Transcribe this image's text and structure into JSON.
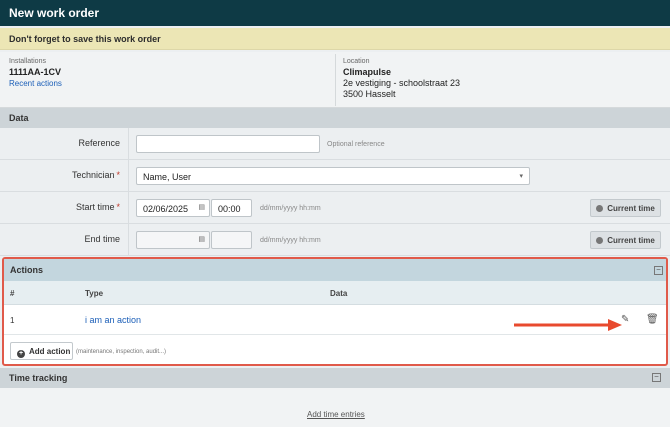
{
  "header": {
    "title": "New work order"
  },
  "banner": {
    "text": "Don't forget to save this work order"
  },
  "info": {
    "installations_label": "Installations",
    "installation_code": "1111AA-1CV",
    "recent_actions": "Recent actions",
    "location_label": "Location",
    "location_name": "Climapulse",
    "location_line1": "2e vestiging - schoolstraat 23",
    "location_line2": "3500 Hasselt"
  },
  "data_section": {
    "title": "Data",
    "reference": {
      "label": "Reference",
      "value": "",
      "hint": "Optional reference"
    },
    "technician": {
      "label": "Technician",
      "required": "*",
      "value": "Name, User"
    },
    "start_time": {
      "label": "Start time",
      "required": "*",
      "date": "02/06/2025",
      "time": "00:00",
      "hint": "dd/mm/yyyy hh:mm",
      "button": "Current time"
    },
    "end_time": {
      "label": "End time",
      "date": "",
      "time": "",
      "hint": "dd/mm/yyyy hh:mm",
      "button": "Current time"
    }
  },
  "actions": {
    "title": "Actions",
    "collapse": "−",
    "columns": {
      "num": "#",
      "type": "Type",
      "data": "Data"
    },
    "rows": [
      {
        "num": "1",
        "type": "i am an action",
        "data": ""
      }
    ],
    "add_button": "Add action",
    "add_hint": "(maintenance, inspection, audit...)",
    "icons": {
      "edit": "pencil-icon",
      "delete": "trash-icon"
    },
    "arrow_color": "#e84a2e"
  },
  "time_tracking": {
    "title": "Time tracking",
    "collapse": "−",
    "link": "Add time entries"
  }
}
